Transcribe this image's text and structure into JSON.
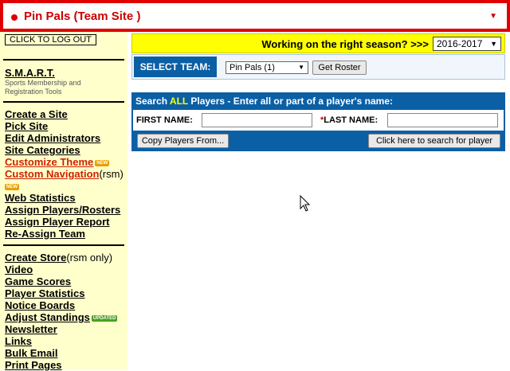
{
  "site": {
    "name": "Pin Pals (Team Site )",
    "caret": "▼"
  },
  "sidebar": {
    "logout_label": "CLICK TO LOG OUT",
    "smart_title": "S.M.A.R.T.",
    "smart_subtitle": "Sports Membership and Registration Tools",
    "group1": [
      {
        "label": "Create a Site"
      },
      {
        "label": "Pick Site"
      },
      {
        "label": "Edit Administrators"
      },
      {
        "label": "Site Categories"
      },
      {
        "label": "Customize Theme",
        "badge": "NEW"
      },
      {
        "label": "Custom Navigation",
        "suffix": "(rsm)",
        "badge": "NEW"
      },
      {
        "label": "Web Statistics"
      },
      {
        "label": "Assign Players/Rosters"
      },
      {
        "label": "Assign Player Report"
      },
      {
        "label": "Re-Assign Team"
      }
    ],
    "group2": [
      {
        "label": "Create Store",
        "suffix": "(rsm only)"
      },
      {
        "label": "Video"
      },
      {
        "label": "Game Scores"
      },
      {
        "label": "Player Statistics"
      },
      {
        "label": "Notice Boards"
      },
      {
        "label": "Adjust Standings",
        "badge": "UPDATED"
      },
      {
        "label": "Newsletter"
      },
      {
        "label": "Links"
      },
      {
        "label": "Bulk Email"
      },
      {
        "label": "Print Pages"
      }
    ]
  },
  "season": {
    "prompt": "Working on the right season? >>>",
    "value": "2016-2017",
    "caret": "▼"
  },
  "team": {
    "label": "SELECT TEAM:",
    "value": "Pin Pals (1)",
    "caret": "▼",
    "roster_button": "Get Roster"
  },
  "search": {
    "title_prefix": "Search ",
    "title_all": "ALL",
    "title_suffix": " Players - Enter all or part of a player's name:",
    "first_name_label": "FIRST NAME:",
    "last_name_label": "LAST NAME:",
    "required_mark": "*",
    "first_name_value": "",
    "last_name_value": "",
    "copy_button": "Copy Players From...",
    "search_button": "Click here to search for player"
  },
  "colors": {
    "brand_red": "#e00000",
    "panel_blue": "#0b5fa5",
    "sidebar_bg": "#ffffcc",
    "season_bg": "#ffff00"
  }
}
